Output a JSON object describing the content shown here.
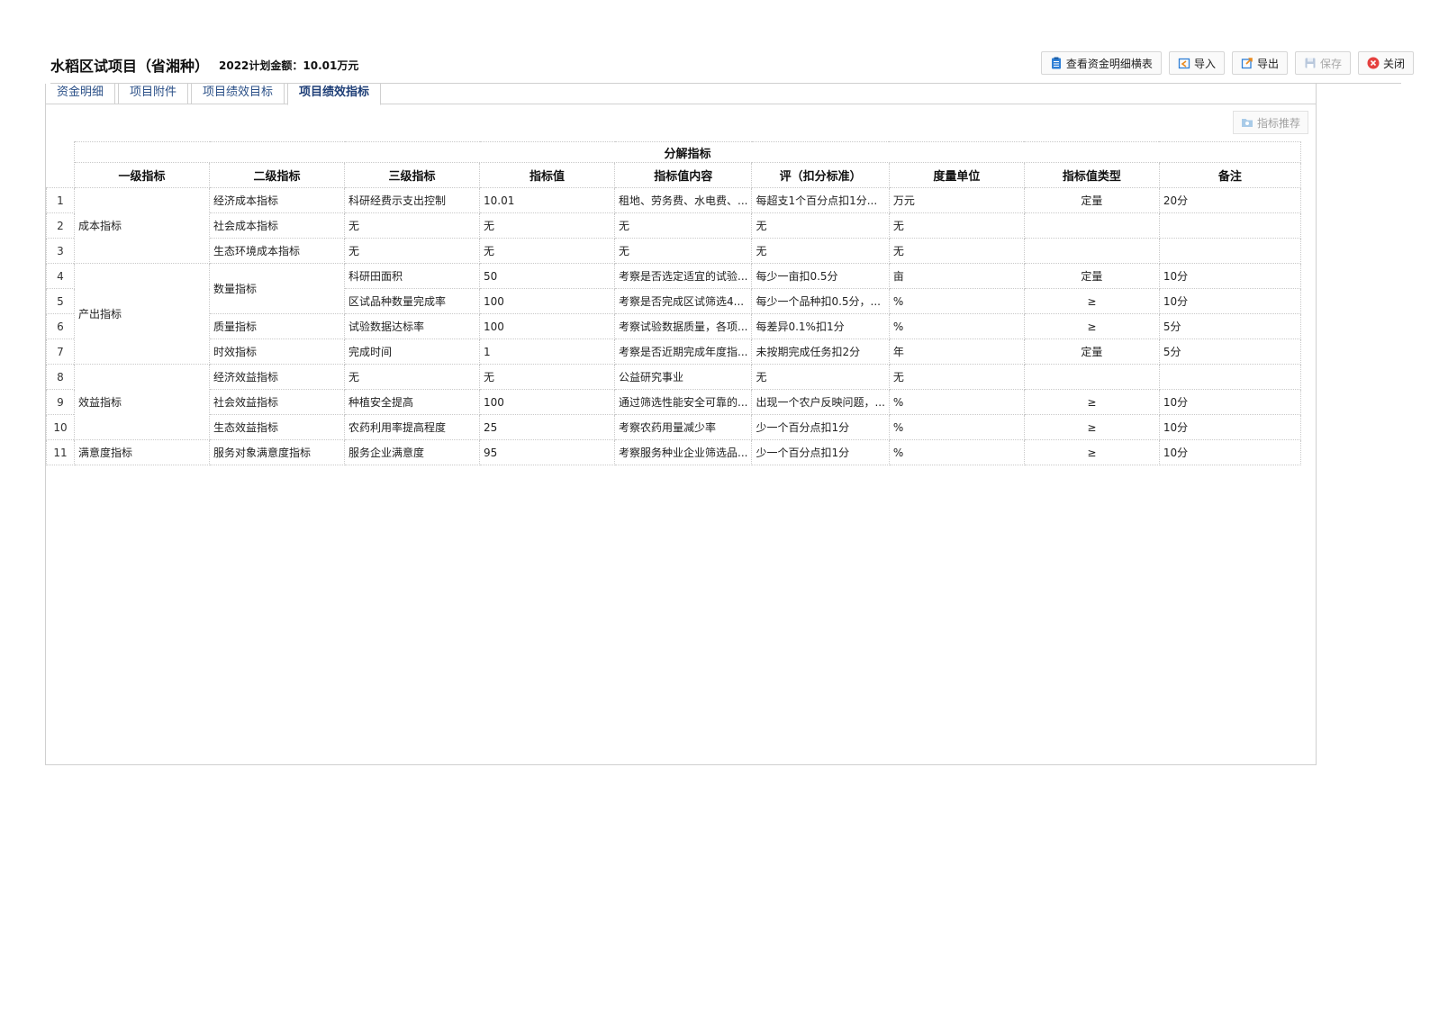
{
  "header": {
    "title": "水稻区试项目（省湘种）",
    "subtitle": "2022计划金额：10.01万元"
  },
  "toolbar": {
    "view_detail_label": "查看资金明细横表",
    "import_label": "导入",
    "export_label": "导出",
    "save_label": "保存",
    "close_label": "关闭"
  },
  "tabs": [
    {
      "label": "资金明细"
    },
    {
      "label": "项目附件"
    },
    {
      "label": "项目绩效目标"
    },
    {
      "label": "项目绩效指标"
    }
  ],
  "recommend_label": "指标推荐",
  "table": {
    "super_header": "分解指标",
    "columns": [
      "一级指标",
      "二级指标",
      "三级指标",
      "指标值",
      "指标值内容",
      "评（扣分标准）",
      "度量单位",
      "指标值类型",
      "备注"
    ],
    "rows": [
      {
        "no": "1",
        "l1": "成本指标",
        "l2": "经济成本指标",
        "l3": "科研经费示支出控制",
        "value": "10.01",
        "content": "租地、劳务费、水电费、...",
        "standard": "每超支1个百分点扣1分...",
        "unit": "万元",
        "type": "定量",
        "note": "20分"
      },
      {
        "no": "2",
        "l2": "社会成本指标",
        "l3": "无",
        "value": "无",
        "content": "无",
        "standard": "无",
        "unit": "无",
        "type": "",
        "note": ""
      },
      {
        "no": "3",
        "l2": "生态环境成本指标",
        "l3": "无",
        "value": "无",
        "content": "无",
        "standard": "无",
        "unit": "无",
        "type": "",
        "note": ""
      },
      {
        "no": "4",
        "l1": "产出指标",
        "l2": "数量指标",
        "l3": "科研田面积",
        "value": "50",
        "content": "考察是否选定适宜的试验...",
        "standard": "每少一亩扣0.5分",
        "unit": "亩",
        "type": "定量",
        "note": "10分"
      },
      {
        "no": "5",
        "l3": "区试品种数量完成率",
        "value": "100",
        "content": "考察是否完成区试筛选4...",
        "standard": "每少一个品种扣0.5分，...",
        "unit": "%",
        "type": "≥",
        "note": "10分"
      },
      {
        "no": "6",
        "l2": "质量指标",
        "l3": "试验数据达标率",
        "value": "100",
        "content": "考察试验数据质量，各项...",
        "standard": "每差异0.1%扣1分",
        "unit": "%",
        "type": "≥",
        "note": "5分"
      },
      {
        "no": "7",
        "l2": "时效指标",
        "l3": "完成时间",
        "value": "1",
        "content": "考察是否近期完成年度指...",
        "standard": "未按期完成任务扣2分",
        "unit": "年",
        "type": "定量",
        "note": "5分"
      },
      {
        "no": "8",
        "l1": "效益指标",
        "l2": "经济效益指标",
        "l3": "无",
        "value": "无",
        "content": "公益研究事业",
        "standard": "无",
        "unit": "无",
        "type": "",
        "note": ""
      },
      {
        "no": "9",
        "l2": "社会效益指标",
        "l3": "种植安全提高",
        "value": "100",
        "content": "通过筛选性能安全可靠的...",
        "standard": "出现一个农户反映问题，...",
        "unit": "%",
        "type": "≥",
        "note": "10分"
      },
      {
        "no": "10",
        "l2": "生态效益指标",
        "l3": "农药利用率提高程度",
        "value": "25",
        "content": "考察农药用量减少率",
        "standard": "少一个百分点扣1分",
        "unit": "%",
        "type": "≥",
        "note": "10分"
      },
      {
        "no": "11",
        "l1": "满意度指标",
        "l2": "服务对象满意度指标",
        "l3": "服务企业满意度",
        "value": "95",
        "content": "考察服务种业企业筛选品...",
        "standard": "少一个百分点扣1分",
        "unit": "%",
        "type": "≥",
        "note": "10分"
      }
    ]
  },
  "icons": {
    "view_detail": "clipboard-icon",
    "import": "import-icon",
    "export": "export-icon",
    "save": "floppy-icon",
    "close": "close-circle-icon",
    "recommend": "folder-icon"
  },
  "colors": {
    "accent": "#2f7fd6",
    "close_red": "#e5413f",
    "tab_text": "#2a4f87"
  }
}
